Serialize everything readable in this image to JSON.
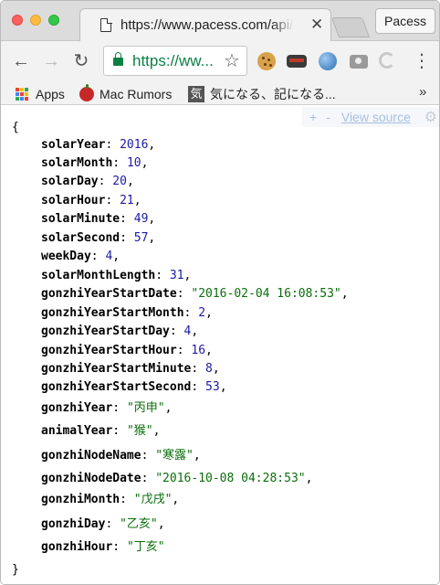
{
  "tab": {
    "title": "https://www.pacess.com/api/",
    "close_glyph": "✕"
  },
  "profile": {
    "label": "Pacess"
  },
  "toolbar": {
    "back_glyph": "←",
    "forward_glyph": "→",
    "reload_glyph": "↻",
    "address_text": "https://ww...",
    "star_glyph": "☆",
    "menu_glyph": "⋮",
    "icons": [
      "lock-icon",
      "star-icon",
      "cookie-extension-icon",
      "mask-extension-icon",
      "globe-extension-icon",
      "camera-extension-icon",
      "swirl-extension-icon",
      "menu-icon"
    ]
  },
  "bookmarks": {
    "items": [
      {
        "label": "Apps",
        "icon": "apps-grid-icon"
      },
      {
        "label": "Mac Rumors",
        "icon": "apple-icon"
      },
      {
        "label": "気になる、記になる...",
        "icon": "kini-icon",
        "icon_glyph": "気"
      }
    ],
    "more_glyph": "»",
    "apps_colors": [
      "#ea4335",
      "#fbbc05",
      "#34a853",
      "#4285f4",
      "#ea4335",
      "#fbbc05",
      "#34a853",
      "#4285f4",
      "#ea4335"
    ]
  },
  "viewer": {
    "plus": "+",
    "minus": "-",
    "view_source": "View source",
    "gear_glyph": "⚙"
  },
  "json": {
    "open_brace": "{",
    "close_brace": "}",
    "entries": [
      {
        "key": "solarYear",
        "value": "2016",
        "type": "num"
      },
      {
        "key": "solarMonth",
        "value": "10",
        "type": "num"
      },
      {
        "key": "solarDay",
        "value": "20",
        "type": "num"
      },
      {
        "key": "solarHour",
        "value": "21",
        "type": "num"
      },
      {
        "key": "solarMinute",
        "value": "49",
        "type": "num"
      },
      {
        "key": "solarSecond",
        "value": "57",
        "type": "num"
      },
      {
        "key": "weekDay",
        "value": "4",
        "type": "num"
      },
      {
        "key": "solarMonthLength",
        "value": "31",
        "type": "num"
      },
      {
        "key": "gonzhiYearStartDate",
        "value": "\"2016-02-04 16:08:53\"",
        "type": "str"
      },
      {
        "key": "gonzhiYearStartMonth",
        "value": "2",
        "type": "num"
      },
      {
        "key": "gonzhiYearStartDay",
        "value": "4",
        "type": "num"
      },
      {
        "key": "gonzhiYearStartHour",
        "value": "16",
        "type": "num"
      },
      {
        "key": "gonzhiYearStartMinute",
        "value": "8",
        "type": "num"
      },
      {
        "key": "gonzhiYearStartSecond",
        "value": "53",
        "type": "num"
      },
      {
        "key": "gonzhiYear",
        "value": "\"丙申\"",
        "type": "str"
      },
      {
        "key": "animalYear",
        "value": "\"猴\"",
        "type": "str"
      },
      {
        "key": "gonzhiNodeName",
        "value": "\"寒露\"",
        "type": "str"
      },
      {
        "key": "gonzhiNodeDate",
        "value": "\"2016-10-08 04:28:53\"",
        "type": "str"
      },
      {
        "key": "gonzhiMonth",
        "value": "\"戊戌\"",
        "type": "str"
      },
      {
        "key": "gonzhiDay",
        "value": "\"乙亥\"",
        "type": "str"
      },
      {
        "key": "gonzhiHour",
        "value": "\"丁亥\"",
        "type": "str",
        "last": true
      }
    ]
  }
}
